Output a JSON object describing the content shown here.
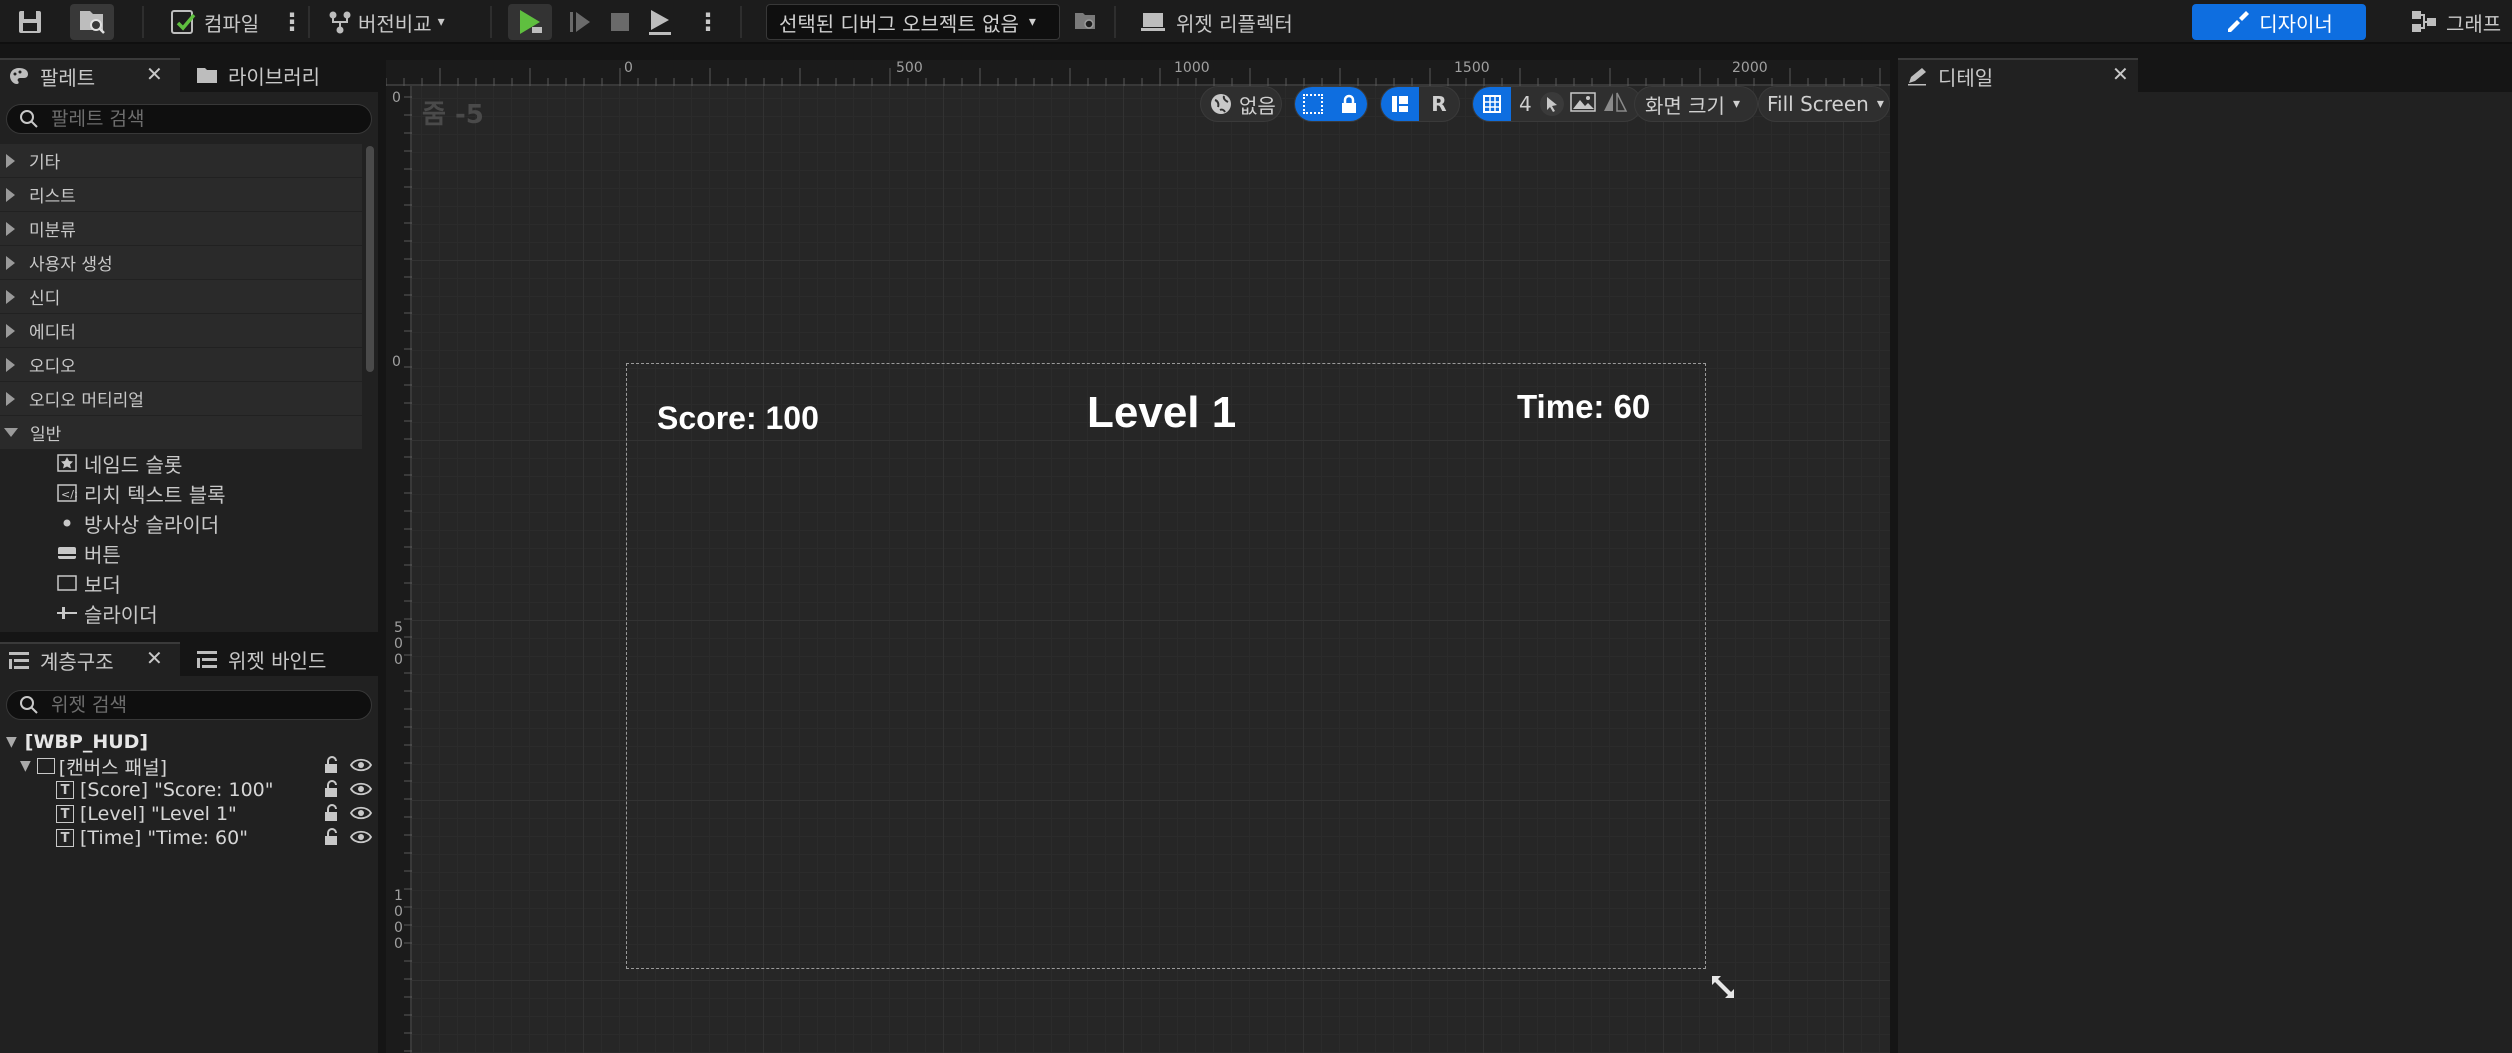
{
  "toolbar": {
    "compile_label": "컴파일",
    "diff_label": "버전비교",
    "debug_object": "선택된 디버그 오브젝트 없음",
    "widget_reflector": "위젯 리플렉터",
    "designer_label": "디자이너",
    "graph_label": "그래프"
  },
  "palette": {
    "tab_label": "팔레트",
    "library_tab": "라이브러리",
    "search_placeholder": "팔레트 검색",
    "categories": [
      "기타",
      "리스트",
      "미분류",
      "사용자 생성",
      "신디",
      "에디터",
      "오디오",
      "오디오 머티리얼",
      "일반"
    ],
    "items": [
      "네임드 슬롯",
      "리치 텍스트 블록",
      "방사상 슬라이더",
      "버튼",
      "보더",
      "슬라이더"
    ]
  },
  "hierarchy": {
    "tab_label": "계층구조",
    "bindings_tab": "위젯 바인드",
    "search_placeholder": "위젯 검색",
    "root": "[WBP_HUD]",
    "canvas": "[캔버스 패널]",
    "children": [
      "[Score] \"Score: 100\"",
      "[Level] \"Level 1\"",
      "[Time] \"Time: 60\""
    ]
  },
  "viewport": {
    "zoom_label": "줌 -5",
    "world_label": "없음",
    "r_label": "R",
    "grid_snap": "4",
    "screen_size_label": "화면 크기",
    "fill_mode": "Fill Screen",
    "ruler_top": [
      "0",
      "0",
      "500",
      "1000",
      "1500",
      "2000"
    ],
    "ruler_left": [
      "0",
      "0",
      "5\n0\n0",
      "1\n0\n0\n0"
    ]
  },
  "hud": {
    "score": "Score: 100",
    "level": "Level 1",
    "time": "Time: 60"
  },
  "details": {
    "tab_label": "디테일"
  },
  "colors": {
    "accent": "#0e6ee0",
    "play_green": "#4caf50"
  }
}
